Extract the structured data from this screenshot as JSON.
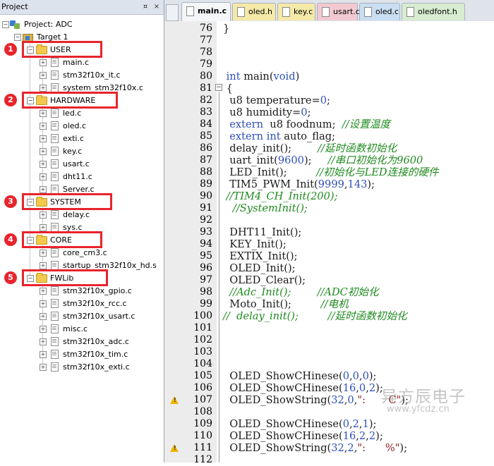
{
  "project_panel": {
    "title": "Project",
    "pin_button": "¤",
    "close_button": "×",
    "project_label": "Project: ADC",
    "target_label": "Target 1",
    "groups": [
      {
        "badge": "1",
        "name": "USER",
        "files": [
          "main.c",
          "stm32f10x_it.c",
          "system_stm32f10x.c"
        ]
      },
      {
        "badge": "2",
        "name": "HARDWARE",
        "files": [
          "led.c",
          "oled.c",
          "exti.c",
          "key.c",
          "usart.c",
          "dht11.c",
          "Server.c"
        ]
      },
      {
        "badge": "3",
        "name": "SYSTEM",
        "files": [
          "delay.c",
          "sys.c"
        ]
      },
      {
        "badge": "4",
        "name": "CORE",
        "files": [
          "core_cm3.c",
          "startup_stm32f10x_hd.s"
        ]
      },
      {
        "badge": "5",
        "name": "FWLib",
        "files": [
          "stm32f10x_gpio.c",
          "stm32f10x_rcc.c",
          "stm32f10x_usart.c",
          "misc.c",
          "stm32f10x_adc.c",
          "stm32f10x_tim.c",
          "stm32f10x_exti.c"
        ]
      }
    ]
  },
  "tabs": [
    {
      "label": "main.c",
      "color": "#f4f6f8",
      "active": true
    },
    {
      "label": "oled.h",
      "color": "#f5e9a8",
      "active": false
    },
    {
      "label": "key.c",
      "color": "#f5e9a8",
      "active": false
    },
    {
      "label": "usart.c",
      "color": "#f3c9d1",
      "active": false
    },
    {
      "label": "oled.c",
      "color": "#c9def3",
      "active": false
    },
    {
      "label": "oledfont.h",
      "color": "#d7ecd0",
      "active": false
    }
  ],
  "editor": {
    "lines": [
      {
        "n": "76",
        "code": [
          [
            "}",
            ""
          ]
        ]
      },
      {
        "n": "77",
        "code": []
      },
      {
        "n": "78",
        "code": []
      },
      {
        "n": "79",
        "code": []
      },
      {
        "n": "80",
        "code": [
          [
            " ",
            ""
          ],
          [
            "int",
            "kw"
          ],
          [
            " main(",
            ""
          ],
          [
            "void",
            "kw"
          ],
          [
            ")",
            ""
          ]
        ]
      },
      {
        "n": "81",
        "code": [
          [
            " {",
            ""
          ]
        ]
      },
      {
        "n": "82",
        "code": [
          [
            "  u8 temperature=",
            ""
          ],
          [
            "0",
            "num"
          ],
          [
            ";",
            ""
          ]
        ]
      },
      {
        "n": "83",
        "code": [
          [
            "  u8 humidity=",
            ""
          ],
          [
            "0",
            "num"
          ],
          [
            ";",
            ""
          ]
        ]
      },
      {
        "n": "84",
        "code": [
          [
            "  ",
            ""
          ],
          [
            "extern",
            "kw"
          ],
          [
            "  u8 foodnum;  ",
            ""
          ],
          [
            "//设置温度",
            "cm"
          ]
        ]
      },
      {
        "n": "85",
        "code": [
          [
            "  ",
            ""
          ],
          [
            "extern",
            "kw"
          ],
          [
            " ",
            ""
          ],
          [
            "int",
            "kw"
          ],
          [
            " auto_flag;",
            ""
          ]
        ]
      },
      {
        "n": "86",
        "code": [
          [
            "  delay_init();        ",
            ""
          ],
          [
            "//延时函数初始化",
            "cm"
          ]
        ]
      },
      {
        "n": "87",
        "code": [
          [
            "  uart_init(",
            ""
          ],
          [
            "9600",
            "num"
          ],
          [
            ");     ",
            ""
          ],
          [
            "//串口初始化为9600",
            "cm"
          ]
        ]
      },
      {
        "n": "88",
        "code": [
          [
            "  LED_Init();         ",
            ""
          ],
          [
            "//初始化与LED连接的硬件",
            "cm"
          ]
        ]
      },
      {
        "n": "89",
        "code": [
          [
            "  TIM5_PWM_Init(",
            ""
          ],
          [
            "9999",
            "num"
          ],
          [
            ",",
            ""
          ],
          [
            "143",
            "num"
          ],
          [
            ");",
            ""
          ]
        ]
      },
      {
        "n": "90",
        "code": [
          [
            " ",
            ""
          ],
          [
            "//TIM4_CH_Init(200);",
            "cm"
          ]
        ]
      },
      {
        "n": "91",
        "code": [
          [
            "   ",
            ""
          ],
          [
            "//SystemInit();",
            "cm"
          ]
        ]
      },
      {
        "n": "92",
        "code": []
      },
      {
        "n": "93",
        "code": [
          [
            "  DHT11_Init();",
            ""
          ]
        ]
      },
      {
        "n": "94",
        "code": [
          [
            "  KEY_Init();",
            ""
          ]
        ]
      },
      {
        "n": "95",
        "code": [
          [
            "  EXTIX_Init();",
            ""
          ]
        ]
      },
      {
        "n": "96",
        "code": [
          [
            "  OLED_Init();",
            ""
          ]
        ]
      },
      {
        "n": "97",
        "code": [
          [
            "  OLED_Clear();",
            ""
          ]
        ]
      },
      {
        "n": "98",
        "code": [
          [
            "  ",
            ""
          ],
          [
            "//Adc_Init();        //ADC初始化",
            "cm"
          ]
        ]
      },
      {
        "n": "99",
        "code": [
          [
            "  Moto_Init();         ",
            ""
          ],
          [
            "//电机",
            "cm"
          ]
        ]
      },
      {
        "n": "100",
        "code": [
          [
            "",
            ""
          ],
          [
            "//  delay_init();         //延时函数初始化",
            "cm"
          ]
        ]
      },
      {
        "n": "101",
        "code": []
      },
      {
        "n": "102",
        "code": []
      },
      {
        "n": "103",
        "code": []
      },
      {
        "n": "104",
        "code": []
      },
      {
        "n": "105",
        "code": [
          [
            "  OLED_ShowCHinese(",
            ""
          ],
          [
            "0",
            "num"
          ],
          [
            ",",
            ""
          ],
          [
            "0",
            "num"
          ],
          [
            ",",
            ""
          ],
          [
            "0",
            "num"
          ],
          [
            ");",
            ""
          ]
        ]
      },
      {
        "n": "106",
        "code": [
          [
            "  OLED_ShowCHinese(",
            ""
          ],
          [
            "16",
            "num"
          ],
          [
            ",",
            ""
          ],
          [
            "0",
            "num"
          ],
          [
            ",",
            ""
          ],
          [
            "2",
            "num"
          ],
          [
            ");",
            ""
          ]
        ]
      },
      {
        "n": "107",
        "code": [
          [
            "  OLED_ShowString(",
            ""
          ],
          [
            "32",
            "num"
          ],
          [
            ",",
            ""
          ],
          [
            "0",
            "num"
          ],
          [
            ",",
            ""
          ],
          [
            "\":       C\"",
            "str"
          ],
          [
            ");",
            ""
          ]
        ]
      },
      {
        "n": "108",
        "code": []
      },
      {
        "n": "109",
        "code": [
          [
            "  OLED_ShowCHinese(",
            ""
          ],
          [
            "0",
            "num"
          ],
          [
            ",",
            ""
          ],
          [
            "2",
            "num"
          ],
          [
            ",",
            ""
          ],
          [
            "1",
            "num"
          ],
          [
            ");",
            ""
          ]
        ]
      },
      {
        "n": "110",
        "code": [
          [
            "  OLED_ShowCHinese(",
            ""
          ],
          [
            "16",
            "num"
          ],
          [
            ",",
            ""
          ],
          [
            "2",
            "num"
          ],
          [
            ",",
            ""
          ],
          [
            "2",
            "num"
          ],
          [
            ");",
            ""
          ]
        ]
      },
      {
        "n": "111",
        "code": [
          [
            "  OLED_ShowString(",
            ""
          ],
          [
            "32",
            "num"
          ],
          [
            ",",
            ""
          ],
          [
            "2",
            "num"
          ],
          [
            ",",
            ""
          ],
          [
            "\":      %\"",
            "str"
          ],
          [
            ");",
            ""
          ]
        ]
      },
      {
        "n": "112",
        "code": []
      }
    ],
    "warning_lines": [
      "107",
      "111"
    ]
  },
  "watermark": {
    "title": "异方辰电子",
    "url": "www.yfcdz.cn"
  }
}
